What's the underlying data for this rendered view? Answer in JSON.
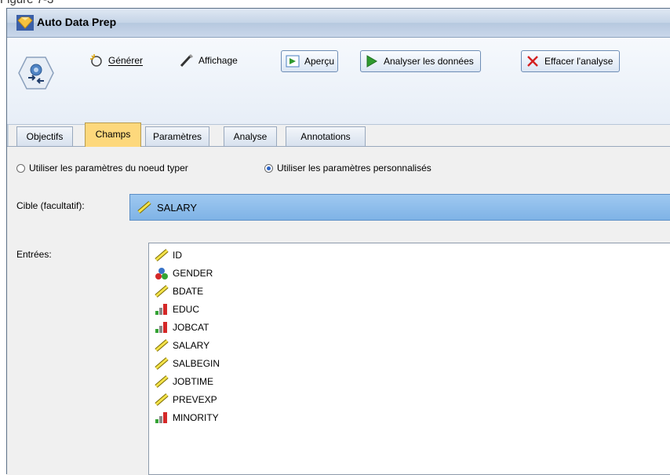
{
  "caption": "Figure 7-3",
  "window": {
    "title": "Auto Data Prep"
  },
  "toolbar": {
    "generate_label": "Générer",
    "view_label": "Affichage",
    "preview_label": "Aperçu",
    "analyze_label": "Analyser les données",
    "clear_label": "Effacer l'analyse"
  },
  "tabs": [
    {
      "label": "Objectifs"
    },
    {
      "label": "Champs"
    },
    {
      "label": "Paramètres"
    },
    {
      "label": "Analyse"
    },
    {
      "label": "Annotations"
    }
  ],
  "active_tab": "Champs",
  "settings": {
    "radio_type_node": "Utiliser les paramètres du noeud typer",
    "radio_custom": "Utiliser les paramètres personnalisés",
    "selected": "custom"
  },
  "target": {
    "label": "Cible (facultatif):",
    "value": "SALARY",
    "icon": "ruler-icon"
  },
  "inputs": {
    "label": "Entrées:",
    "items": [
      {
        "name": "ID",
        "icon": "ruler-icon"
      },
      {
        "name": "GENDER",
        "icon": "nominal-icon"
      },
      {
        "name": "BDATE",
        "icon": "ruler-icon"
      },
      {
        "name": "EDUC",
        "icon": "ordinal-icon"
      },
      {
        "name": "JOBCAT",
        "icon": "ordinal-icon"
      },
      {
        "name": "SALARY",
        "icon": "ruler-icon"
      },
      {
        "name": "SALBEGIN",
        "icon": "ruler-icon"
      },
      {
        "name": "JOBTIME",
        "icon": "ruler-icon"
      },
      {
        "name": "PREVEXP",
        "icon": "ruler-icon"
      },
      {
        "name": "MINORITY",
        "icon": "ordinal-icon"
      }
    ]
  },
  "colors": {
    "active_tab": "#fdd87c",
    "target_bg": "#8fbdeb",
    "accent": "#2a62c5"
  }
}
